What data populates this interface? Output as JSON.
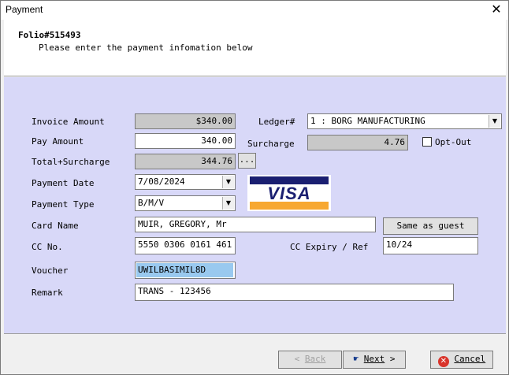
{
  "window": {
    "title": "Payment",
    "close_glyph": "✕"
  },
  "header": {
    "folio": "Folio#515493",
    "instruction": "Please enter the payment infomation below"
  },
  "form": {
    "invoice_amount": {
      "label": "Invoice Amount",
      "value": "$340.00"
    },
    "ledger": {
      "label": "Ledger#",
      "value": "1 : BORG MANUFACTURING"
    },
    "pay_amount": {
      "label": "Pay Amount",
      "value": "340.00"
    },
    "surcharge": {
      "label": "Surcharge",
      "value": "4.76"
    },
    "opt_out": {
      "label": "Opt-Out",
      "checked": false
    },
    "total_surcharge": {
      "label": "Total+Surcharge",
      "value": "344.76",
      "ellipsis": "..."
    },
    "payment_date": {
      "label": "Payment Date",
      "value": "7/08/2024"
    },
    "payment_type": {
      "label": "Payment Type",
      "value": "B/M/V"
    },
    "card_logo": {
      "text": "VISA",
      "icon": "visa-card-icon"
    },
    "card_name": {
      "label": "Card Name",
      "value": "MUIR, GREGORY, Mr"
    },
    "same_as_guest": {
      "label": "Same as guest"
    },
    "cc_no": {
      "label": "CC No.",
      "value": "5550 0306 0161 461"
    },
    "cc_expiry": {
      "label": "CC Expiry / Ref",
      "value": "10/24"
    },
    "voucher": {
      "label": "Voucher",
      "value": "UWILBASIMIL8D"
    },
    "remark": {
      "label": "Remark",
      "value": "TRANS - 123456"
    }
  },
  "footer": {
    "back": {
      "label": "Back",
      "prefix": "< ",
      "enabled": false
    },
    "next": {
      "label": "Next",
      "suffix": " >"
    },
    "cancel": {
      "label": "Cancel"
    }
  },
  "colors": {
    "panel_bg": "#d8d8f8",
    "readonly_bg": "#c8c8c8",
    "selection_bg": "#99c9ef",
    "visa_blue": "#1a1f71",
    "visa_gold": "#f7a832",
    "cancel_red": "#d9342b"
  }
}
